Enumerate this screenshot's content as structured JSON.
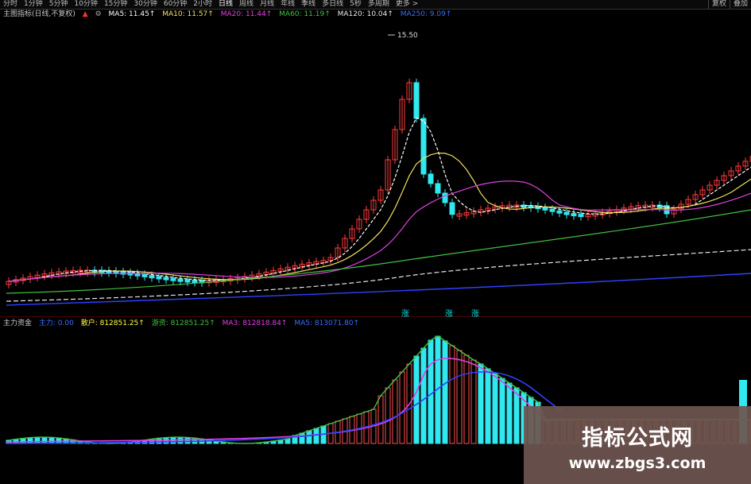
{
  "toolbar": {
    "items": [
      "分时",
      "1分钟",
      "5分钟",
      "10分钟",
      "15分钟",
      "30分钟",
      "60分钟",
      "2小时",
      "日线",
      "周线",
      "月线",
      "年线",
      "季线",
      "多日线",
      "5秒",
      "多周期",
      "更多 >"
    ],
    "active_index": 8,
    "right_items": [
      "复权",
      "叠加"
    ]
  },
  "main_legend": {
    "title": "主图指标(日线,不复权)",
    "ma5": "MA5: 11.45↑",
    "ma10": "MA10: 11.57↑",
    "ma20": "MA20: 11.44↑",
    "ma60": "MA60: 11.19↑",
    "ma120": "MA120: 10.04↑",
    "ma250": "MA250: 9.09↑",
    "colors": {
      "ma5": "#ffffff",
      "ma10": "#f0e060",
      "ma20": "#e040e0",
      "ma60": "#40c040",
      "ma120": "#e8e8e8",
      "ma250": "#3040ff"
    }
  },
  "high_label": "15.50",
  "signals": [
    "涨",
    "涨",
    "涨"
  ],
  "sub_legend": {
    "title": "主力资金",
    "v1": "主力: 0.00",
    "v2": "散户: 812851.25↑",
    "v3": "游资: 812851.25↑",
    "v4": "MA3: 812818.84↑",
    "v5": "MA5: 813071.80↑",
    "colors": {
      "v1": "#3b6bff",
      "v2": "#ffff40",
      "v3": "#40c040",
      "v4": "#e040e0",
      "v5": "#3b6bff"
    }
  },
  "watermark": {
    "title": "指标公式网",
    "url": "www.zbgs3.com"
  }
}
